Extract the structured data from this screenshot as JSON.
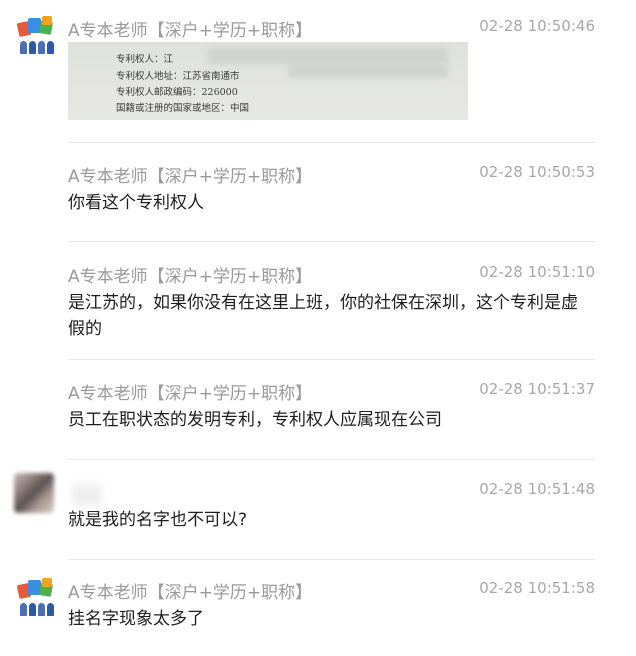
{
  "messages": [
    {
      "sender": "A专本老师【深户+学历+职称】",
      "time": "02-28 10:50:46",
      "type": "image",
      "image_lines": [
        "专利权人：江",
        "专利权人地址：江苏省南通市",
        "专利权人邮政编码：226000",
        "国籍或注册的国家或地区：中国"
      ]
    },
    {
      "sender": "A专本老师【深户+学历+职称】",
      "time": "02-28 10:50:53",
      "text": "你看这个专利权人"
    },
    {
      "sender": "A专本老师【深户+学历+职称】",
      "time": "02-28 10:51:10",
      "text": "是江苏的，如果你没有在这里上班，你的社保在深圳，这个专利是虚假的"
    },
    {
      "sender": "A专本老师【深户+学历+职称】",
      "time": "02-28 10:51:37",
      "text": "员工在职状态的发明专利，专利权人应属现在公司"
    },
    {
      "sender": "",
      "time": "02-28 10:51:48",
      "text": "就是我的名字也不可以?"
    },
    {
      "sender": "A专本老师【深户+学历+职称】",
      "time": "02-28 10:51:58",
      "text": "挂名字现象太多了"
    }
  ]
}
